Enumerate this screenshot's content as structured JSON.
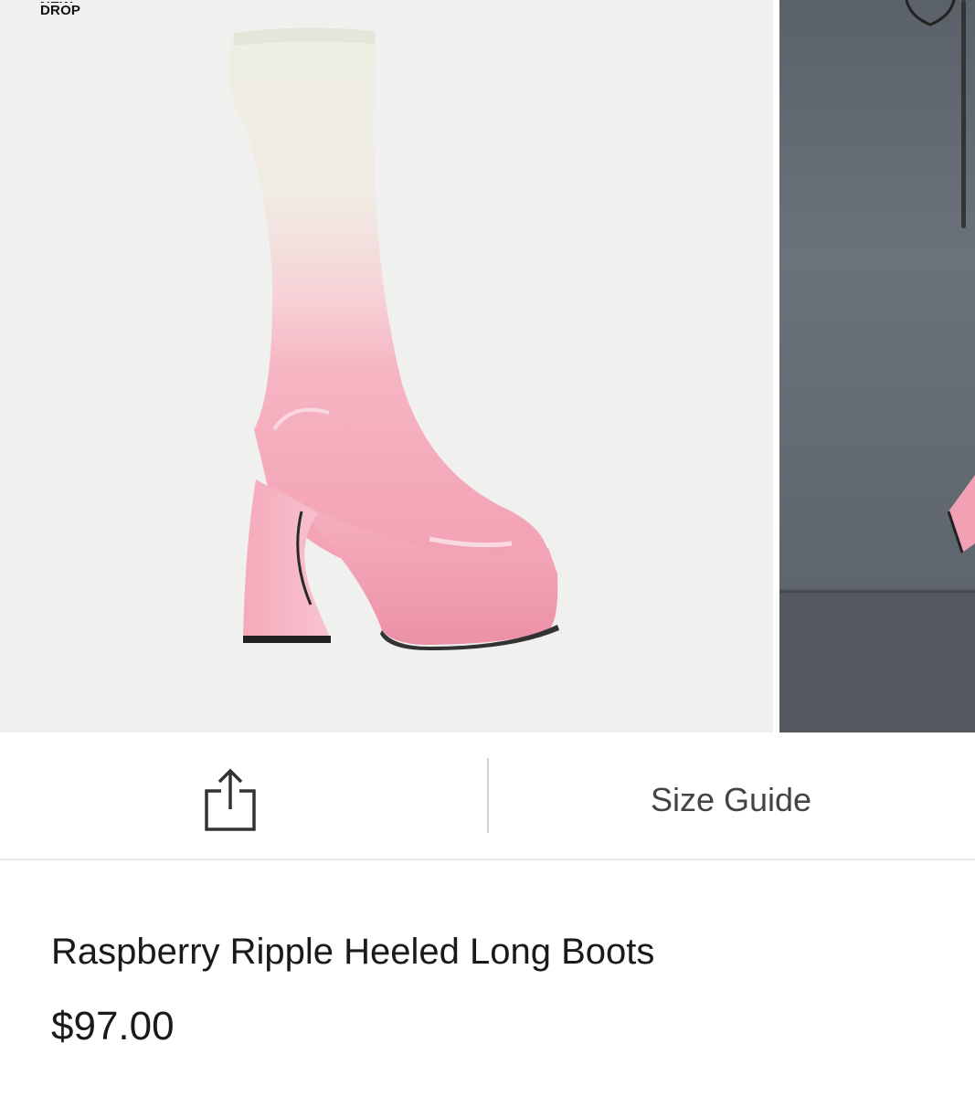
{
  "gallery": {
    "badge_line1": "NEW",
    "badge_line2": "DROP",
    "main_image_alt": "Raspberry Ripple Heeled Long Boots - side view",
    "next_image_alt": "Raspberry Ripple Heeled Long Boots - model"
  },
  "actions": {
    "share_icon": "share-icon",
    "size_guide_label": "Size Guide"
  },
  "product": {
    "title": "Raspberry Ripple Heeled Long Boots",
    "price": "$97.00"
  },
  "colors": {
    "boot_pink": "#f3a8ba",
    "boot_white": "#eeeee4",
    "text": "#1a1a1a"
  }
}
